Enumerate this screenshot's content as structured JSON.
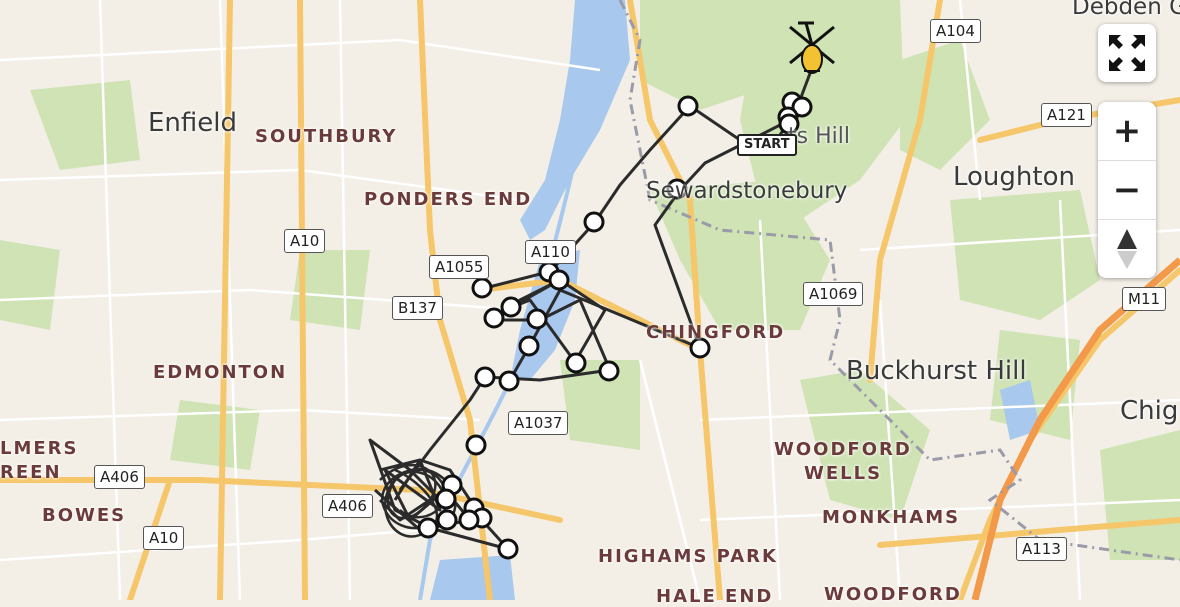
{
  "places": [
    {
      "key": "enfield",
      "label": "Enfield",
      "type": "town"
    },
    {
      "key": "southbury",
      "label": "SOUTHBURY",
      "type": "district"
    },
    {
      "key": "ponders_end",
      "label": "PONDERS END",
      "type": "district"
    },
    {
      "key": "edmonton",
      "label": "EDMONTON",
      "type": "district"
    },
    {
      "key": "palmers_green",
      "label": "LMERS",
      "type": "district"
    },
    {
      "key": "palmers_green2",
      "label": "REEN",
      "type": "district"
    },
    {
      "key": "bowes",
      "label": "BOWES",
      "type": "district"
    },
    {
      "key": "sewardstonebury",
      "label": "Sewardstonebury",
      "type": "town"
    },
    {
      "key": "chingford",
      "label": "CHINGFORD",
      "type": "district"
    },
    {
      "key": "loughton",
      "label": "Loughton",
      "type": "town"
    },
    {
      "key": "buckhurst_hill",
      "label": "Buckhurst Hill",
      "type": "town"
    },
    {
      "key": "chigwell",
      "label": "Chig",
      "type": "town"
    },
    {
      "key": "woodford_wells1",
      "label": "WOODFORD",
      "type": "district"
    },
    {
      "key": "woodford_wells2",
      "label": "WELLS",
      "type": "district"
    },
    {
      "key": "monkhams",
      "label": "MONKHAMS",
      "type": "district"
    },
    {
      "key": "highams_park",
      "label": "HIGHAMS PARK",
      "type": "district"
    },
    {
      "key": "hale_end",
      "label": "HALE END",
      "type": "district"
    },
    {
      "key": "woodford",
      "label": "WOODFORD",
      "type": "district"
    },
    {
      "key": "debden",
      "label": "Debden G",
      "type": "town"
    },
    {
      "key": "pole_hill",
      "label": "ts Hill",
      "type": "town"
    }
  ],
  "roads": [
    "A104",
    "A121",
    "A10",
    "A1055",
    "A110",
    "B137",
    "A1069",
    "M11",
    "A1037",
    "A406",
    "A406",
    "A10",
    "A113"
  ],
  "start_label": "START",
  "controls": {
    "fullscreen": "fullscreen-icon",
    "zoom_in": "+",
    "zoom_out": "−",
    "compass": "compass-icon"
  },
  "colors": {
    "route": "#2b2b2b",
    "water": "#a8c8ee",
    "park": "#cfe3b5",
    "major_road": "#f6c66a",
    "marker": "#ffffff",
    "helicopter": "#f2c230"
  }
}
